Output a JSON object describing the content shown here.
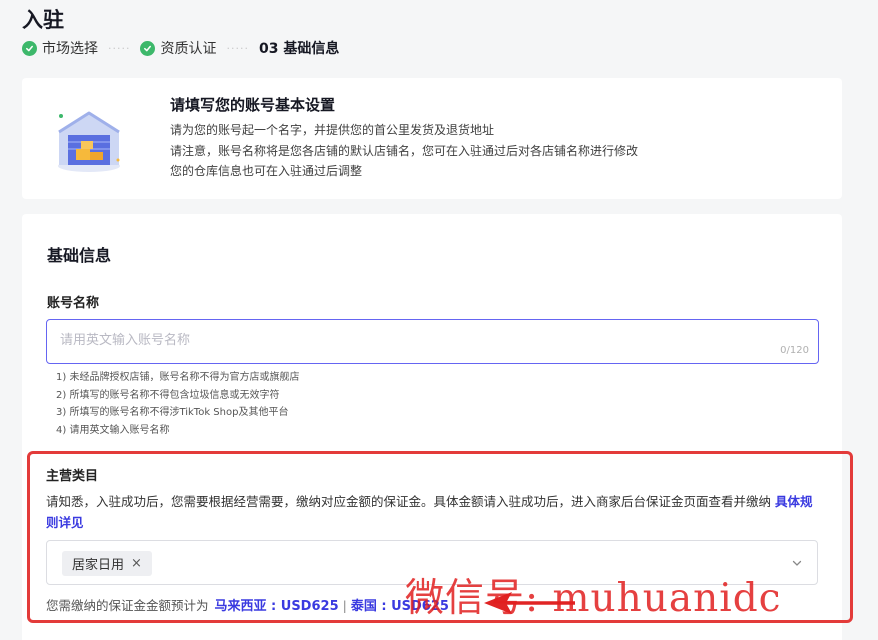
{
  "page": {
    "title": "入驻"
  },
  "steps": [
    {
      "label": "市场选择",
      "done": true
    },
    {
      "label": "资质认证",
      "done": true
    },
    {
      "label": "03 基础信息",
      "done": false
    }
  ],
  "step_separator": "·····",
  "intro": {
    "title": "请填写您的账号基本设置",
    "lines": [
      "请为您的账号起一个名字，并提供您的首公里发货及退货地址",
      "请注意，账号名称将是您各店铺的默认店铺名，您可在入驻通过后对各店铺名称进行修改",
      "您的仓库信息也可在入驻通过后调整"
    ]
  },
  "form": {
    "section_title": "基础信息",
    "account_name": {
      "label": "账号名称",
      "placeholder": "请用英文输入账号名称",
      "counter": "0/120",
      "rules": [
        "1) 未经品牌授权店铺，账号名称不得为官方店或旗舰店",
        "2) 所填写的账号名称不得包含垃圾信息或无效字符",
        "3) 所填写的账号名称不得涉TikTok Shop及其他平台",
        "4) 请用英文输入账号名称"
      ]
    },
    "main_category": {
      "label": "主营类目",
      "description": "请知悉，入驻成功后，您需要根据经营需要，缴纳对应金额的保证金。具体金额请入驻成功后，进入商家后台保证金页面查看并缴纳",
      "link": "具体规则详见",
      "selected_tag": "居家日用",
      "tag_close": "×"
    },
    "deposit": {
      "prefix": "您需缴纳的保证金金额预计为",
      "malaysia": "马来西亚 : USD625",
      "separator": "|",
      "thailand": "泰国 : USD625"
    }
  },
  "watermark": {
    "text": "微信号: muhuanidc"
  },
  "colors": {
    "accent": "#3a3ae0",
    "input_focus_border": "#6565f2",
    "success": "#3db86b",
    "highlight_border": "#e33b3a",
    "page_bg": "#f5f6f7"
  },
  "icons": {
    "step_done": "check-circle-icon",
    "intro": "warehouse-illustration",
    "select": "chevron-down-icon",
    "annotation": "red-arrow-icon"
  }
}
